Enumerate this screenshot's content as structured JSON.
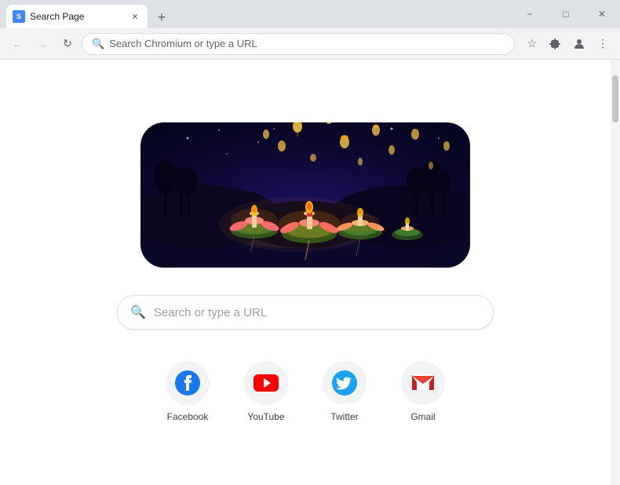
{
  "titleBar": {
    "tab": {
      "title": "Search Page",
      "favicon": "S"
    },
    "newTabLabel": "+",
    "controls": {
      "minimize": "−",
      "maximize": "□",
      "close": "✕"
    }
  },
  "toolbar": {
    "backLabel": "←",
    "forwardLabel": "→",
    "reloadLabel": "↻",
    "addressPlaceholder": "Search Chromium or type a URL",
    "starIcon": "☆",
    "extensionIcon": "🧩",
    "profileIcon": "👤",
    "menuIcon": "⋮"
  },
  "page": {
    "searchPlaceholder": "Search or type a URL",
    "shortcuts": [
      {
        "label": "Facebook"
      },
      {
        "label": "YouTube"
      },
      {
        "label": "Twitter"
      },
      {
        "label": "Gmail"
      }
    ]
  }
}
